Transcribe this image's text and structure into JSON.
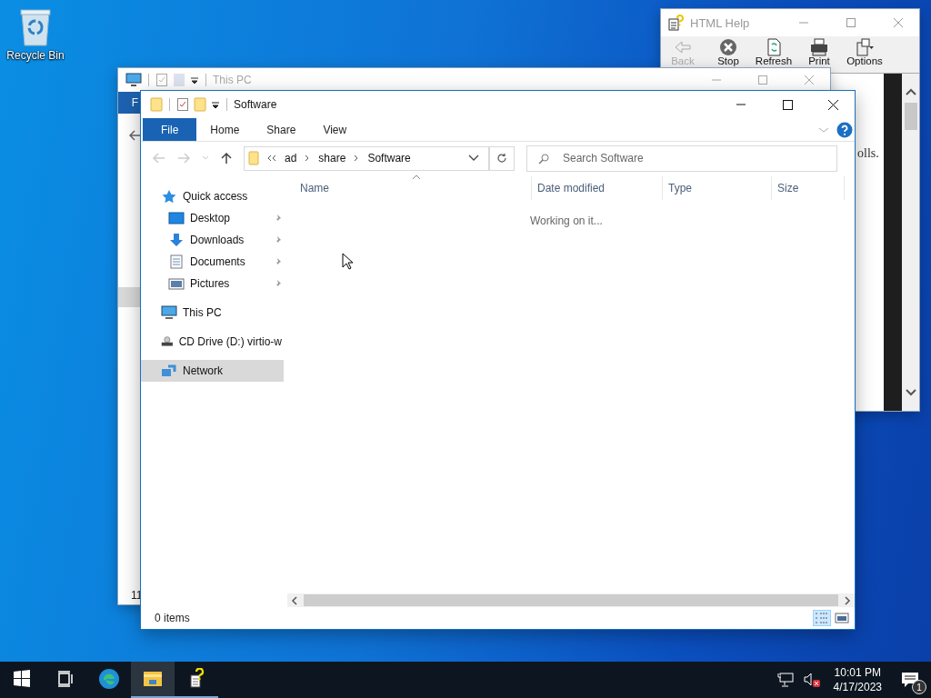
{
  "desktop": {
    "icons": [
      {
        "label": "Recycle Bin"
      }
    ]
  },
  "help_window": {
    "title": "HTML Help",
    "toolbar": [
      {
        "kind": "back",
        "label": "Back",
        "disabled": true
      },
      {
        "kind": "stop",
        "label": "Stop",
        "disabled": false
      },
      {
        "kind": "refresh",
        "label": "Refresh",
        "disabled": false
      },
      {
        "kind": "print",
        "label": "Print",
        "disabled": false
      },
      {
        "kind": "options",
        "label": "Options",
        "disabled": false
      }
    ],
    "content_text": "olls."
  },
  "back_window": {
    "title": "This PC",
    "ribbon_tab": "F",
    "status_text": "11"
  },
  "explorer": {
    "title": "Software",
    "ribbon_tabs": [
      {
        "label": "File",
        "selected": true
      },
      {
        "label": "Home",
        "selected": false
      },
      {
        "label": "Share",
        "selected": false
      },
      {
        "label": "View",
        "selected": false
      }
    ],
    "address": {
      "segments": [
        "ad",
        "share",
        "Software"
      ]
    },
    "search": {
      "placeholder": "Search Software"
    },
    "nav": [
      {
        "kind": "quick-access",
        "label": "Quick access",
        "selected": false,
        "children": [
          {
            "kind": "desktop",
            "label": "Desktop",
            "pinned": true,
            "selected": false
          },
          {
            "kind": "downloads",
            "label": "Downloads",
            "pinned": true,
            "selected": false
          },
          {
            "kind": "documents",
            "label": "Documents",
            "pinned": true,
            "selected": false
          },
          {
            "kind": "pictures",
            "label": "Pictures",
            "pinned": true,
            "selected": false
          }
        ]
      },
      {
        "kind": "this-pc",
        "label": "This PC",
        "selected": false
      },
      {
        "kind": "cd-drive",
        "label": "CD Drive (D:) virtio-w",
        "selected": false
      },
      {
        "kind": "network",
        "label": "Network",
        "selected": true
      }
    ],
    "columns": [
      "Name",
      "Date modified",
      "Type",
      "Size"
    ],
    "status_message": "Working on it...",
    "status_bar": "0 items",
    "views": [
      {
        "kind": "details",
        "selected": true
      },
      {
        "kind": "large-icons",
        "selected": false
      }
    ]
  },
  "taskbar": {
    "items": [
      {
        "kind": "start",
        "selected": false,
        "running": false
      },
      {
        "kind": "task-view",
        "selected": false,
        "running": false
      },
      {
        "kind": "edge",
        "selected": false,
        "running": false
      },
      {
        "kind": "explorer",
        "selected": true,
        "running": true
      },
      {
        "kind": "help",
        "selected": false,
        "running": true
      }
    ],
    "time": "10:01 PM",
    "date": "4/17/2023",
    "notification_count": "1"
  }
}
